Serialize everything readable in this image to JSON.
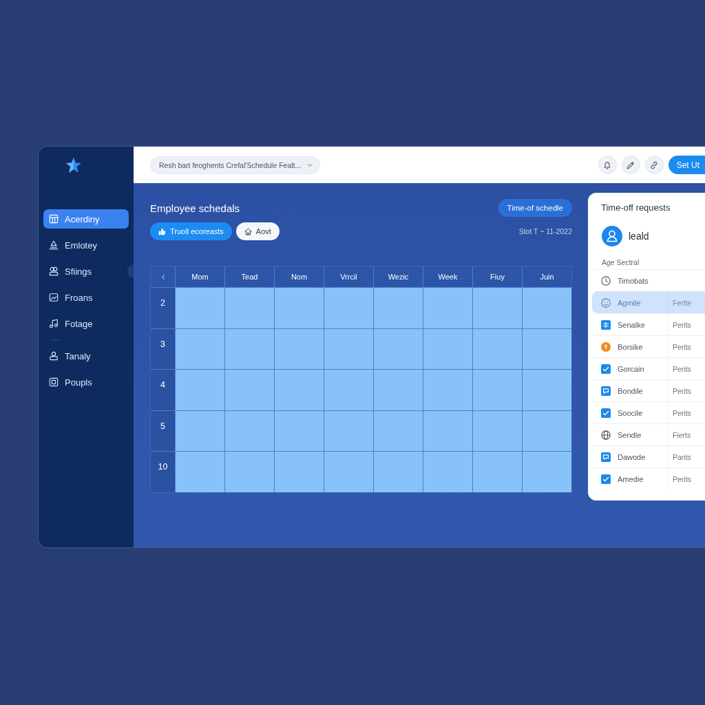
{
  "sidebar": {
    "sections": [
      {
        "items": [
          {
            "label": "Acerdiny",
            "selected": true
          },
          {
            "label": "Emlotey",
            "selected": false
          },
          {
            "label": "Sfiings",
            "selected": false
          },
          {
            "label": "Froans",
            "selected": false
          },
          {
            "label": "Fotage",
            "selected": false
          }
        ]
      },
      {
        "items": [
          {
            "label": "Tanaly",
            "selected": false
          },
          {
            "label": "Poupls",
            "selected": false
          }
        ]
      }
    ]
  },
  "topbar": {
    "dropdown": {
      "value": "Resh bart feoghents Crefal'Schedule Fealt..."
    },
    "action_button": "Set Ut"
  },
  "main": {
    "title": "Employee schedals",
    "schedule_button": "Time-of schedle",
    "buttons": [
      {
        "label": "Truoll ecoreasts",
        "kind": "primary"
      },
      {
        "label": "Aovt",
        "kind": "secondary"
      }
    ],
    "date_range": "Stot T ~ 11-2022"
  },
  "schedule": {
    "columns": [
      "Mom",
      "Tead",
      "Nom",
      "Vrrcil",
      "Wezic",
      "Week",
      "Fiuy",
      "Juin"
    ],
    "rows": [
      "2",
      "3",
      "4",
      "5",
      "10"
    ]
  },
  "panel": {
    "title": "Time-off requests",
    "user": "leald",
    "section": "Age Sectral",
    "requests": [
      {
        "name": "Timobats",
        "selected": false
      },
      {
        "name": "Agmile",
        "column_2": "Ferfte",
        "selected": true
      },
      {
        "name": "Senalke",
        "column_2": "Perits",
        "selected": false
      },
      {
        "name": "Borsike",
        "column_2": "Perits",
        "selected": false
      },
      {
        "name": "Gorcain",
        "column_2": "Perits",
        "selected": false
      },
      {
        "name": "Bondile",
        "column_2": "Perits",
        "selected": false
      },
      {
        "name": "Soocile",
        "column_2": "Perits",
        "selected": false
      },
      {
        "name": "Sendle",
        "column_2": "Fierts",
        "selected": false
      },
      {
        "name": "Dawode",
        "column_2": "Parits",
        "selected": false
      },
      {
        "name": "Amedie",
        "column_2": "Perits",
        "selected": false
      }
    ]
  }
}
